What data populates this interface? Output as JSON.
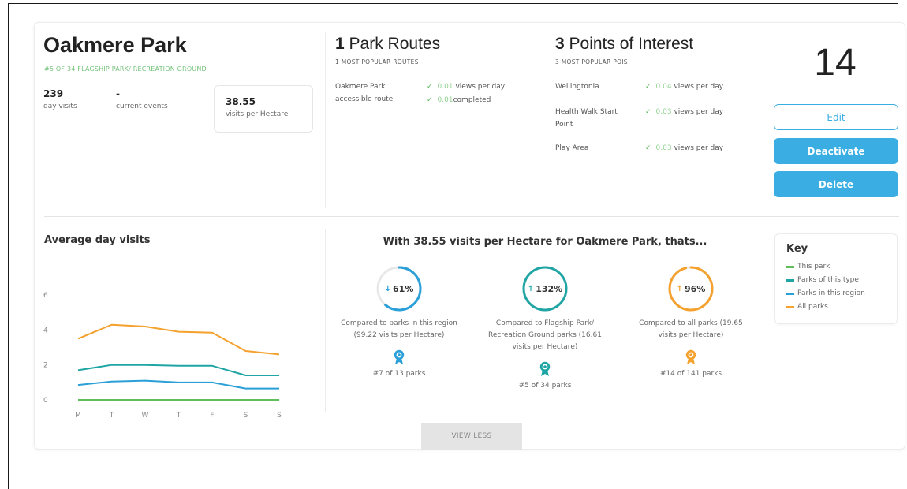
{
  "park": {
    "name": "Oakmere Park",
    "subtitle": "#5 OF 34 FLAGSHIP PARK/ RECREATION GROUND",
    "day_visits_value": "239",
    "day_visits_label": "day visits",
    "events_value": "-",
    "events_label": "current events",
    "per_hectare_value": "38.55",
    "per_hectare_label": "visits per Hectare"
  },
  "routes": {
    "count": "1",
    "title": "Park Routes",
    "subtitle": "1 MOST POPULAR ROUTES",
    "items": [
      {
        "name": "Oakmere Park accessible route",
        "stats": [
          {
            "value": "0.01",
            "suffix": "views per day"
          },
          {
            "value": "0.01",
            "suffix": "completed"
          }
        ]
      }
    ]
  },
  "pois": {
    "count": "3",
    "title": "Points of Interest",
    "subtitle": "3 MOST POPULAR POIS",
    "items": [
      {
        "name": "Wellingtonia",
        "value": "0.04",
        "suffix": "views per day"
      },
      {
        "name": "Health Walk Start Point",
        "value": "0.03",
        "suffix": "views per day"
      },
      {
        "name": "Play Area",
        "value": "0.03",
        "suffix": "views per day"
      }
    ]
  },
  "total_count": "14",
  "actions": {
    "edit": "Edit",
    "deactivate": "Deactivate",
    "delete": "Delete"
  },
  "chart_data": {
    "type": "line",
    "title": "Average day visits",
    "categories": [
      "M",
      "T",
      "W",
      "T",
      "F",
      "S",
      "S"
    ],
    "yticks": [
      "0",
      "2",
      "4",
      "6"
    ],
    "ylim": [
      0,
      6.5
    ],
    "grid": false,
    "series": [
      {
        "color": "#5cbf5c",
        "values": [
          0,
          0,
          0,
          0,
          0,
          0,
          0
        ]
      },
      {
        "color": "#1fa5a3",
        "values": [
          1.7,
          2.0,
          2.0,
          1.95,
          1.95,
          1.4,
          1.4
        ]
      },
      {
        "color": "#2a9fd8",
        "values": [
          0.85,
          1.05,
          1.1,
          1.0,
          1.0,
          0.65,
          0.65
        ]
      },
      {
        "color": "#f5a12e",
        "values": [
          3.5,
          4.3,
          4.2,
          3.9,
          3.85,
          2.8,
          2.6
        ]
      }
    ]
  },
  "comparison": {
    "title": "With 38.55 visits per Hectare for Oakmere Park, thats...",
    "items": [
      {
        "arrow": "↓",
        "pct": "61%",
        "pct_value": 61,
        "color": "#2a9fd8",
        "desc": "Compared to parks in this region (99.22 visits per Hectare)",
        "rank": "#7 of 13 parks"
      },
      {
        "arrow": "↑",
        "pct": "132%",
        "pct_value": 100,
        "color": "#1fa5a3",
        "desc": "Compared to Flagship Park/ Recreation Ground parks (16.61 visits per Hectare)",
        "rank": "#5 of 34 parks"
      },
      {
        "arrow": "↑",
        "pct": "96%",
        "pct_value": 96,
        "color": "#f5a12e",
        "desc": "Compared to all parks (19.65 visits per Hectare)",
        "rank": "#14 of 141 parks"
      }
    ]
  },
  "key": {
    "title": "Key",
    "items": [
      {
        "label": "This park",
        "color": "#5cbf5c"
      },
      {
        "label": "Parks of this type",
        "color": "#1fa5a3"
      },
      {
        "label": "Parks in this region",
        "color": "#2a9fd8"
      },
      {
        "label": "All parks",
        "color": "#f5a12e"
      }
    ]
  },
  "view_less": "VIEW LESS"
}
